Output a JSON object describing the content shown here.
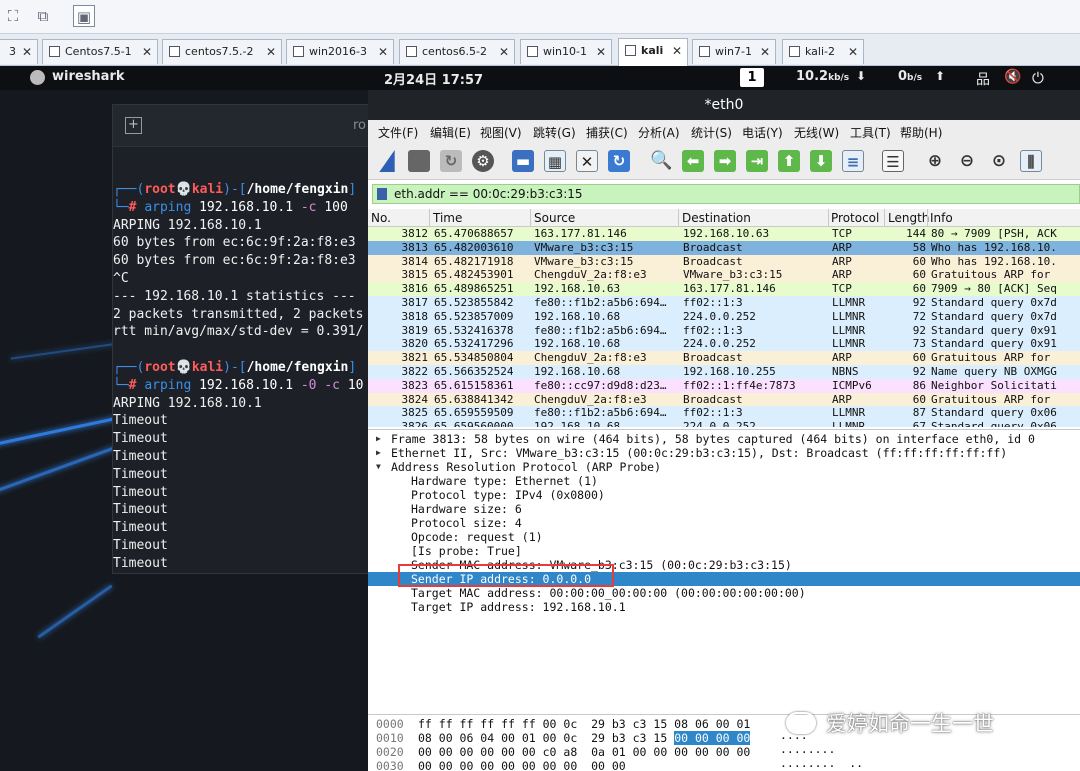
{
  "vm_tabs": [
    {
      "label": "3",
      "active": false
    },
    {
      "label": "Centos7.5-1",
      "active": false
    },
    {
      "label": "centos7.5.-2",
      "active": false
    },
    {
      "label": "win2016-3",
      "active": false
    },
    {
      "label": "centos6.5-2",
      "active": false
    },
    {
      "label": "win10-1",
      "active": false
    },
    {
      "label": "kali",
      "active": true
    },
    {
      "label": "win7-1",
      "active": false
    },
    {
      "label": "kali-2",
      "active": false
    }
  ],
  "panel": {
    "app_name": "wireshark",
    "datetime": "2月24日  17:57",
    "workspace": "1",
    "down_value": "10.2",
    "down_unit": "kb/s",
    "down_arrow": "⬇",
    "up_value": "0",
    "up_unit": "b/s",
    "up_arrow": "⬆"
  },
  "terminal": {
    "title_fragment": "ro",
    "prompt_user": "root",
    "prompt_host": "kali",
    "prompt_path": "/home/fengxin",
    "cmd1_name": "arping",
    "cmd1_args": " 192.168.10.1 ",
    "cmd1_flag": "-c",
    "cmd1_num": " 100",
    "out1": [
      "ARPING 192.168.10.1",
      "60 bytes from ec:6c:9f:2a:f8:e3",
      "60 bytes from ec:6c:9f:2a:f8:e3",
      "^C",
      "--- 192.168.10.1 statistics ---",
      "2 packets transmitted, 2 packets",
      "rtt min/avg/max/std-dev = 0.391/"
    ],
    "cmd2_name": "arping",
    "cmd2_args": " 192.168.10.1 ",
    "cmd2_flag": "-0 -c",
    "cmd2_num": " 10",
    "out2": [
      "ARPING 192.168.10.1",
      "Timeout",
      "Timeout",
      "Timeout",
      "Timeout",
      "Timeout",
      "Timeout",
      "Timeout",
      "Timeout",
      "Timeout"
    ]
  },
  "wireshark": {
    "window_title": "*eth0",
    "menu": [
      "文件(F)",
      "编辑(E)",
      "视图(V)",
      "跳转(G)",
      "捕获(C)",
      "分析(A)",
      "统计(S)",
      "电话(Y)",
      "无线(W)",
      "工具(T)",
      "帮助(H)"
    ],
    "filter": "eth.addr == 00:0c:29:b3:c3:15",
    "columns": [
      "No.",
      "Time",
      "Source",
      "Destination",
      "Protocol",
      "Length",
      "Info"
    ],
    "packets": [
      {
        "no": "3812",
        "time": "65.470688657",
        "src": "163.177.81.146",
        "dst": "192.168.10.63",
        "proto": "TCP",
        "len": "144",
        "info": "80 → 7909 [PSH, ACK",
        "color": "#e7fbcd"
      },
      {
        "no": "3813",
        "time": "65.482003610",
        "src": "VMware_b3:c3:15",
        "dst": "Broadcast",
        "proto": "ARP",
        "len": "58",
        "info": "Who has 192.168.10.",
        "color": "#7fb3de"
      },
      {
        "no": "3814",
        "time": "65.482171918",
        "src": "VMware_b3:c3:15",
        "dst": "Broadcast",
        "proto": "ARP",
        "len": "60",
        "info": "Who has 192.168.10.",
        "color": "#faf0d7"
      },
      {
        "no": "3815",
        "time": "65.482453901",
        "src": "ChengduV_2a:f8:e3",
        "dst": "VMware_b3:c3:15",
        "proto": "ARP",
        "len": "60",
        "info": "Gratuitous ARP for",
        "color": "#faf0d7"
      },
      {
        "no": "3816",
        "time": "65.489865251",
        "src": "192.168.10.63",
        "dst": "163.177.81.146",
        "proto": "TCP",
        "len": "60",
        "info": "7909 → 80 [ACK] Seq",
        "color": "#e7fbcd"
      },
      {
        "no": "3817",
        "time": "65.523855842",
        "src": "fe80::f1b2:a5b6:694…",
        "dst": "ff02::1:3",
        "proto": "LLMNR",
        "len": "92",
        "info": "Standard query 0x7d",
        "color": "#daeefe"
      },
      {
        "no": "3818",
        "time": "65.523857009",
        "src": "192.168.10.68",
        "dst": "224.0.0.252",
        "proto": "LLMNR",
        "len": "72",
        "info": "Standard query 0x7d",
        "color": "#daeefe"
      },
      {
        "no": "3819",
        "time": "65.532416378",
        "src": "fe80::f1b2:a5b6:694…",
        "dst": "ff02::1:3",
        "proto": "LLMNR",
        "len": "92",
        "info": "Standard query 0x91",
        "color": "#daeefe"
      },
      {
        "no": "3820",
        "time": "65.532417296",
        "src": "192.168.10.68",
        "dst": "224.0.0.252",
        "proto": "LLMNR",
        "len": "73",
        "info": "Standard query 0x91",
        "color": "#daeefe"
      },
      {
        "no": "3821",
        "time": "65.534850804",
        "src": "ChengduV_2a:f8:e3",
        "dst": "Broadcast",
        "proto": "ARP",
        "len": "60",
        "info": "Gratuitous ARP for",
        "color": "#faf0d7"
      },
      {
        "no": "3822",
        "time": "65.566352524",
        "src": "192.168.10.68",
        "dst": "192.168.10.255",
        "proto": "NBNS",
        "len": "92",
        "info": "Name query NB OXMGG",
        "color": "#daeefe"
      },
      {
        "no": "3823",
        "time": "65.615158361",
        "src": "fe80::cc97:d9d8:d23…",
        "dst": "ff02::1:ff4e:7873",
        "proto": "ICMPv6",
        "len": "86",
        "info": "Neighbor Solicitati",
        "color": "#fce0ff"
      },
      {
        "no": "3824",
        "time": "65.638841342",
        "src": "ChengduV_2a:f8:e3",
        "dst": "Broadcast",
        "proto": "ARP",
        "len": "60",
        "info": "Gratuitous ARP for",
        "color": "#faf0d7"
      },
      {
        "no": "3825",
        "time": "65.659559509",
        "src": "fe80::f1b2:a5b6:694…",
        "dst": "ff02::1:3",
        "proto": "LLMNR",
        "len": "87",
        "info": "Standard query 0x06",
        "color": "#daeefe"
      },
      {
        "no": "3826",
        "time": "65.659560000",
        "src": "192.168.10.68",
        "dst": "224.0.0.252",
        "proto": "LLMNR",
        "len": "67",
        "info": "Standard query 0x06",
        "color": "#daeefe"
      }
    ],
    "details": [
      {
        "text": "Frame 3813: 58 bytes on wire (464 bits), 58 bytes captured (464 bits) on interface eth0, id 0",
        "indent": 0,
        "tri": "▶",
        "sel": false
      },
      {
        "text": "Ethernet II, Src: VMware_b3:c3:15 (00:0c:29:b3:c3:15), Dst: Broadcast (ff:ff:ff:ff:ff:ff)",
        "indent": 0,
        "tri": "▶",
        "sel": false
      },
      {
        "text": "Address Resolution Protocol (ARP Probe)",
        "indent": 0,
        "tri": "▼",
        "sel": false
      },
      {
        "text": "Hardware type: Ethernet (1)",
        "indent": 1,
        "tri": "",
        "sel": false
      },
      {
        "text": "Protocol type: IPv4 (0x0800)",
        "indent": 1,
        "tri": "",
        "sel": false
      },
      {
        "text": "Hardware size: 6",
        "indent": 1,
        "tri": "",
        "sel": false
      },
      {
        "text": "Protocol size: 4",
        "indent": 1,
        "tri": "",
        "sel": false
      },
      {
        "text": "Opcode: request (1)",
        "indent": 1,
        "tri": "",
        "sel": false
      },
      {
        "text": "[Is probe: True]",
        "indent": 1,
        "tri": "",
        "sel": false
      },
      {
        "text": "Sender MAC address: VMware_b3:c3:15 (00:0c:29:b3:c3:15)",
        "indent": 1,
        "tri": "",
        "sel": false
      },
      {
        "text": "Sender IP address: 0.0.0.0",
        "indent": 1,
        "tri": "",
        "sel": true
      },
      {
        "text": "Target MAC address: 00:00:00_00:00:00 (00:00:00:00:00:00)",
        "indent": 1,
        "tri": "",
        "sel": false
      },
      {
        "text": "Target IP address: 192.168.10.1",
        "indent": 1,
        "tri": "",
        "sel": false
      }
    ],
    "hex": [
      {
        "off": "0000",
        "hex_a": "ff ff ff ff ff ff 00 0c  29 b3 c3 15 08 06 00 01",
        "hex_sel": "",
        "ascii": ""
      },
      {
        "off": "0010",
        "hex_a": "08 00 06 04 00 01 00 0c  29 b3 c3 15 ",
        "hex_sel": "00 00 00 00",
        "ascii": "····"
      },
      {
        "off": "0020",
        "hex_a": "00 00 00 00 00 00 c0 a8  0a 01 00 00 00 00 00 00",
        "hex_sel": "",
        "ascii": "········"
      },
      {
        "off": "0030",
        "hex_a": "00 00 00 00 00 00 00 00  00 00",
        "hex_sel": "",
        "ascii": "········  ··"
      }
    ]
  },
  "watermark": "爱婷如命一生一世"
}
